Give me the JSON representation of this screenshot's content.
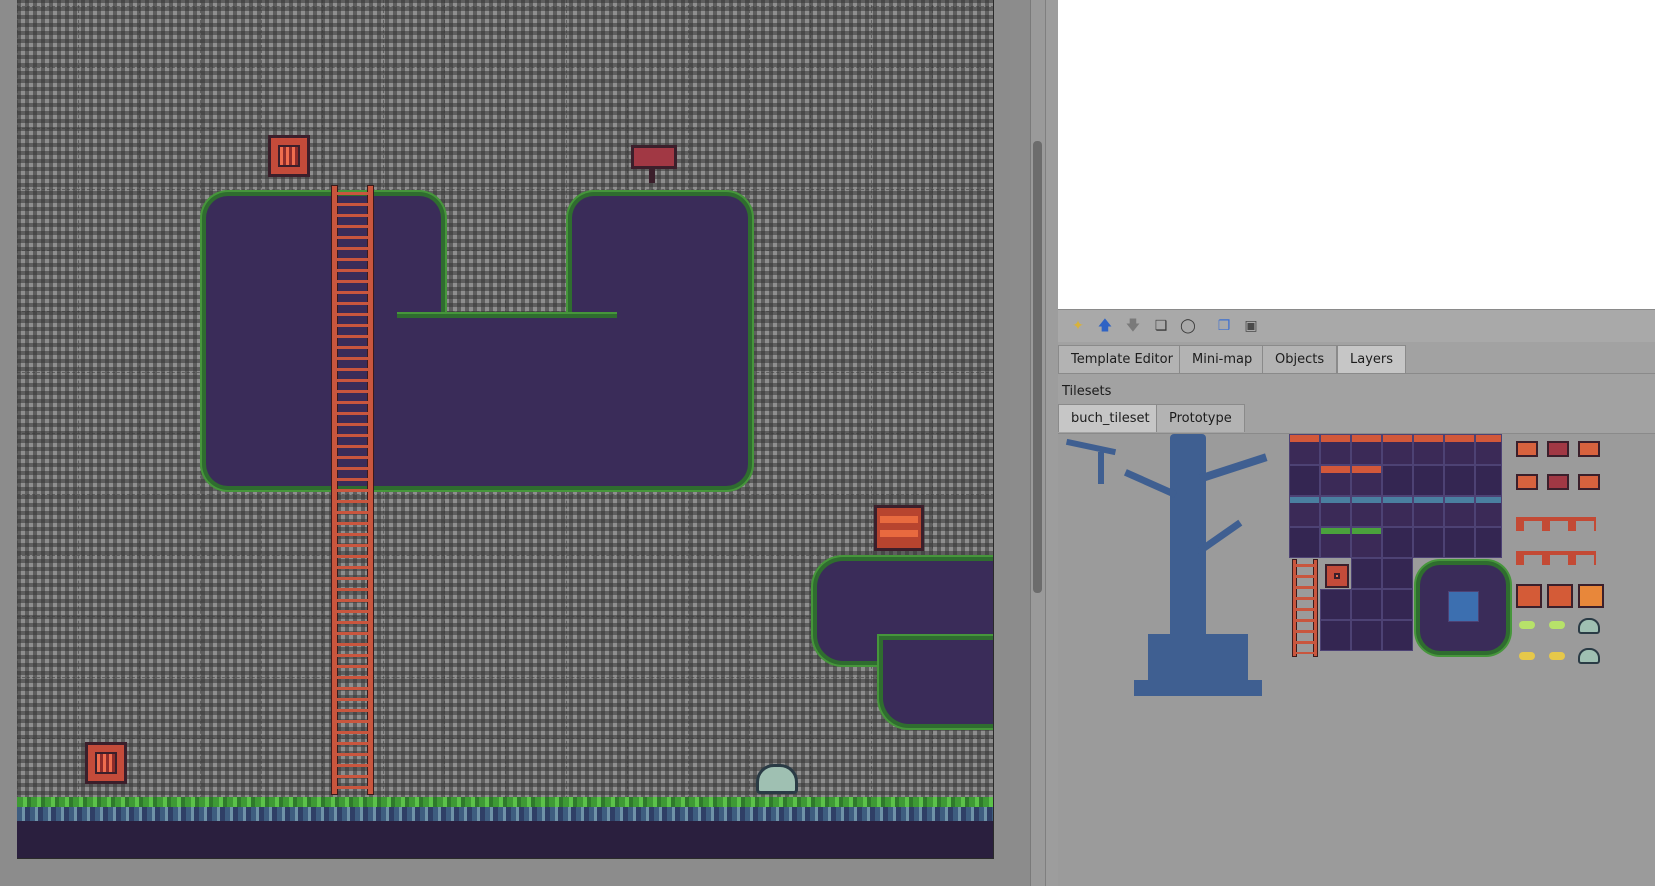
{
  "panel_tabs": {
    "template_editor": "Template Editor",
    "mini_map": "Mini-map",
    "objects": "Objects",
    "layers": "Layers",
    "active": "Layers"
  },
  "tilesets": {
    "title": "Tilesets",
    "tabs": [
      "buch_tileset",
      "Prototype"
    ],
    "active": "buch_tileset"
  },
  "layer_toolbar": {
    "icons": [
      "new-layer-icon",
      "raise-layer-icon",
      "lower-layer-icon",
      "duplicate-layer-icon",
      "remove-layer-icon",
      "show-other-layers-icon",
      "lock-layer-icon"
    ]
  },
  "colors": {
    "map_background": "#8e8e8e",
    "terrain_purple": "#3a2c59",
    "grass_green": "#46963b",
    "ladder_red": "#c9563e",
    "crate_red": "#c44b3a",
    "tree_blue": "#3f5f91"
  }
}
